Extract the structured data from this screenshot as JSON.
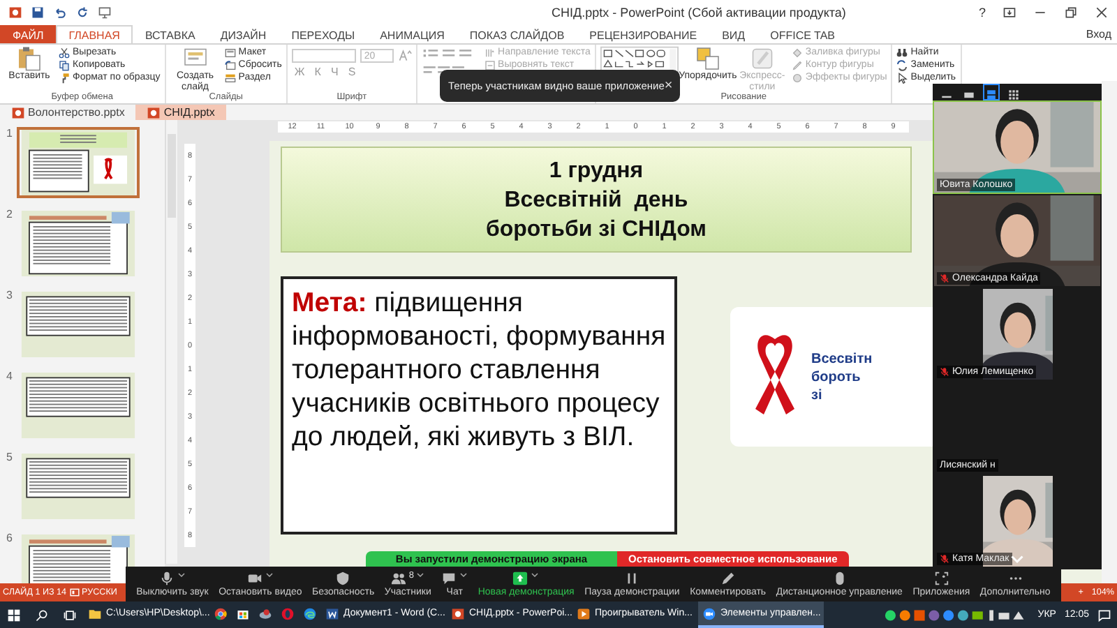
{
  "window": {
    "title": "СНІД.pptx - PowerPoint (Сбой активации продукта)",
    "help": "?"
  },
  "ribbon_tabs": [
    {
      "label": "ФАЙЛ",
      "kind": "file",
      "selected": false
    },
    {
      "label": "ГЛАВНАЯ",
      "kind": "tab",
      "selected": true
    },
    {
      "label": "ВСТАВКА",
      "kind": "tab",
      "selected": false
    },
    {
      "label": "ДИЗАЙН",
      "kind": "tab",
      "selected": false
    },
    {
      "label": "ПЕРЕХОДЫ",
      "kind": "tab",
      "selected": false
    },
    {
      "label": "АНИМАЦИЯ",
      "kind": "tab",
      "selected": false
    },
    {
      "label": "ПОКАЗ СЛАЙДОВ",
      "kind": "tab",
      "selected": false
    },
    {
      "label": "РЕЦЕНЗИРОВАНИЕ",
      "kind": "tab",
      "selected": false
    },
    {
      "label": "ВИД",
      "kind": "tab",
      "selected": false
    },
    {
      "label": "OFFICE TAB",
      "kind": "tab",
      "selected": false
    }
  ],
  "sign_in": "Вход",
  "ribbon_groups": [
    {
      "kind": "buttons",
      "label": "Буфер обмена",
      "large": [
        {
          "label": "Вставить",
          "disabled": false
        }
      ],
      "small": [
        {
          "label": "Вырезать",
          "disabled": false
        },
        {
          "label": "Копировать",
          "disabled": false
        },
        {
          "label": "Формат по образцу",
          "disabled": false
        }
      ]
    },
    {
      "kind": "buttons",
      "label": "Слайды",
      "large": [
        {
          "label": "Создать слайд",
          "disabled": false
        }
      ],
      "small": [
        {
          "label": "Макет",
          "disabled": false
        },
        {
          "label": "Сбросить",
          "disabled": false
        },
        {
          "label": "Раздел",
          "disabled": false
        }
      ]
    },
    {
      "kind": "font",
      "label": "Шрифт",
      "font_size": "20",
      "format_buttons": [
        "Ж",
        "К",
        "Ч",
        "S"
      ]
    },
    {
      "kind": "paragraph",
      "small": [
        {
          "label": "Направление текста",
          "disabled": true
        },
        {
          "label": "Выровнять текст",
          "disabled": true
        }
      ]
    },
    {
      "kind": "drawing",
      "label": "Рисование",
      "large": [
        {
          "label": "Упорядочить",
          "disabled": false
        },
        {
          "label": "Экспресс-стили",
          "disabled": true
        }
      ],
      "small": [
        {
          "label": "Заливка фигуры",
          "disabled": true
        },
        {
          "label": "Контур фигуры",
          "disabled": true
        },
        {
          "label": "Эффекты фигуры",
          "disabled": true
        }
      ]
    },
    {
      "kind": "buttons",
      "small": [
        {
          "label": "Найти",
          "disabled": false
        },
        {
          "label": "Заменить",
          "disabled": false
        },
        {
          "label": "Выделить",
          "disabled": false
        }
      ]
    }
  ],
  "doc_tabs": [
    {
      "label": "Волонтерство.pptx",
      "selected": false
    },
    {
      "label": "СНІД.pptx",
      "selected": true
    }
  ],
  "ruler": {
    "horizontal": [
      "12",
      "11",
      "10",
      "9",
      "8",
      "7",
      "6",
      "5",
      "4",
      "3",
      "2",
      "1",
      "0",
      "1",
      "2",
      "3",
      "4",
      "5",
      "6",
      "7",
      "8",
      "9"
    ],
    "vertical": [
      "8",
      "7",
      "6",
      "5",
      "4",
      "3",
      "2",
      "1",
      "0",
      "1",
      "2",
      "3",
      "4",
      "5",
      "6",
      "7",
      "8"
    ]
  },
  "thumbnails": [
    {
      "number": "1",
      "selected": true,
      "kind": "title"
    },
    {
      "number": "2",
      "selected": false,
      "kind": "list"
    },
    {
      "number": "3",
      "selected": false,
      "kind": "text"
    },
    {
      "number": "4",
      "selected": false,
      "kind": "text"
    },
    {
      "number": "5",
      "selected": false,
      "kind": "text"
    },
    {
      "number": "6",
      "selected": false,
      "kind": "list"
    }
  ],
  "slide": {
    "title_lines": [
      "1 грудня",
      "Всесвітній  день",
      "боротьби зі СНІДом"
    ],
    "body": "**Мета:** підвищення інформованості, формування толерантного ставлення учасників освітнього процесу до людей, які живуть з ВІЛ.",
    "image_text": [
      "Всесвітн",
      "бороть",
      "зі"
    ]
  },
  "status_bar": {
    "slide": "СЛАЙД 1 ИЗ 14",
    "language": "РУССКИ",
    "zoom_plus": "+",
    "zoom": "104%"
  },
  "taskbar": {
    "items": [
      {
        "label": "C:\\Users\\HP\\Desktop\\...",
        "selected": false
      },
      {
        "selected": false
      },
      {
        "selected": false
      },
      {
        "selected": false
      },
      {
        "selected": false
      },
      {
        "selected": false
      },
      {
        "label": "Документ1 - Word (С...",
        "selected": false
      },
      {
        "label": "СНІД.pptx - PowerPoi...",
        "selected": false
      },
      {
        "label": "Проигрыватель Win...",
        "selected": false
      },
      {
        "label": "Элементы управлен...",
        "selected": true
      }
    ],
    "language": "УКР",
    "time": "12:05"
  },
  "zoom": {
    "toast": "Теперь участникам видно ваше приложение",
    "toast_close": "×",
    "share_status": "Вы запустили демонстрацию экрана",
    "stop_share": "Остановить совместное использование",
    "views": [
      {
        "selected": false
      },
      {
        "selected": false
      },
      {
        "selected": true
      },
      {
        "selected": false
      }
    ],
    "participants": [
      {
        "name": "Ювита Колошко",
        "kind": "wide",
        "muted": false,
        "speaking": true
      },
      {
        "name": "Олександра Кайда",
        "kind": "wide",
        "muted": true,
        "speaking": false
      },
      {
        "name": "Юлия Лемищенко",
        "kind": "narrow",
        "muted": true,
        "speaking": false
      },
      {
        "name": "Лисянский н",
        "kind": "none",
        "muted": false,
        "speaking": false
      },
      {
        "name": "Катя Маклак",
        "kind": "narrow",
        "muted": true,
        "speaking": false
      }
    ],
    "toolbar": [
      {
        "label": "Выключить звук",
        "caret": true
      },
      {
        "label": "Остановить видео",
        "caret": true
      },
      {
        "label": "Безопасность",
        "caret": false
      },
      {
        "label": "Участники",
        "badge": "8",
        "caret": true
      },
      {
        "label": "Чат",
        "caret": true
      },
      {
        "label": "Новая демонстрация",
        "kind": "share",
        "caret": true
      },
      {
        "label": "Пауза демонстрации",
        "caret": false
      },
      {
        "label": "Комментировать",
        "caret": false
      },
      {
        "label": "Дистанционное управление",
        "caret": false
      },
      {
        "label": "Приложения",
        "caret": false
      },
      {
        "label": "Дополнительно",
        "caret": false
      }
    ]
  }
}
